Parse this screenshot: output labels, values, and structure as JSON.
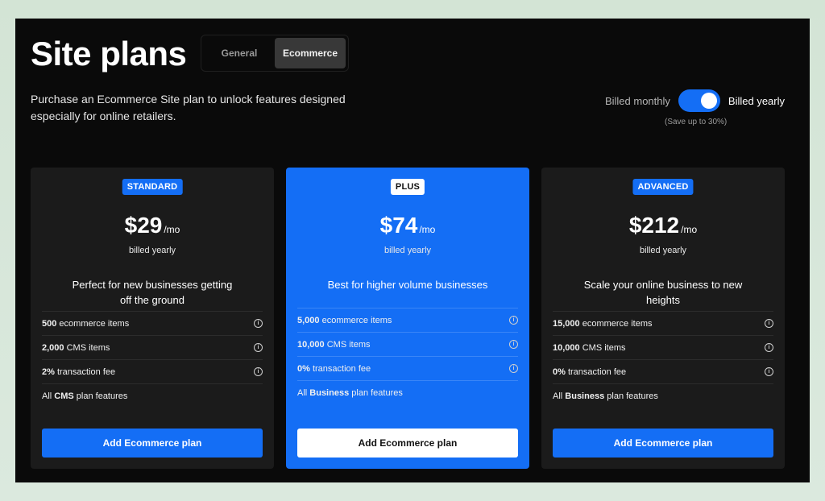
{
  "header": {
    "title": "Site plans",
    "tabs": [
      {
        "label": "General",
        "active": false
      },
      {
        "label": "Ecommerce",
        "active": true
      }
    ],
    "description": "Purchase an Ecommerce Site plan to unlock features designed especially for online retailers."
  },
  "billing": {
    "monthly_label": "Billed monthly",
    "yearly_label": "Billed yearly",
    "savings_note": "(Save up to 30%)",
    "toggle_state": "yearly"
  },
  "colors": {
    "accent": "#146ef5",
    "background": "#0a0a0a",
    "card": "#1b1b1b"
  },
  "plans": [
    {
      "badge": "STANDARD",
      "price": "$29",
      "period": "/mo",
      "billed": "billed yearly",
      "tagline": "Perfect for new businesses getting off the ground",
      "features": [
        {
          "bold": "500",
          "text": " ecommerce items"
        },
        {
          "bold": "2,000",
          "text": " CMS items"
        },
        {
          "bold": "2%",
          "text": " transaction fee"
        },
        {
          "pre": "All ",
          "bold": "CMS",
          "text": " plan features"
        }
      ],
      "cta": "Add Ecommerce plan"
    },
    {
      "badge": "PLUS",
      "price": "$74",
      "period": "/mo",
      "billed": "billed yearly",
      "tagline": "Best for higher volume businesses",
      "features": [
        {
          "bold": "5,000",
          "text": " ecommerce items"
        },
        {
          "bold": "10,000",
          "text": " CMS items"
        },
        {
          "bold": "0%",
          "text": " transaction fee"
        },
        {
          "pre": "All ",
          "bold": "Business",
          "text": " plan features"
        }
      ],
      "cta": "Add Ecommerce plan"
    },
    {
      "badge": "ADVANCED",
      "price": "$212",
      "period": "/mo",
      "billed": "billed yearly",
      "tagline": "Scale your online business to new heights",
      "features": [
        {
          "bold": "15,000",
          "text": " ecommerce items"
        },
        {
          "bold": "10,000",
          "text": " CMS items"
        },
        {
          "bold": "0%",
          "text": " transaction fee"
        },
        {
          "pre": "All ",
          "bold": "Business",
          "text": " plan features"
        }
      ],
      "cta": "Add Ecommerce plan"
    }
  ]
}
